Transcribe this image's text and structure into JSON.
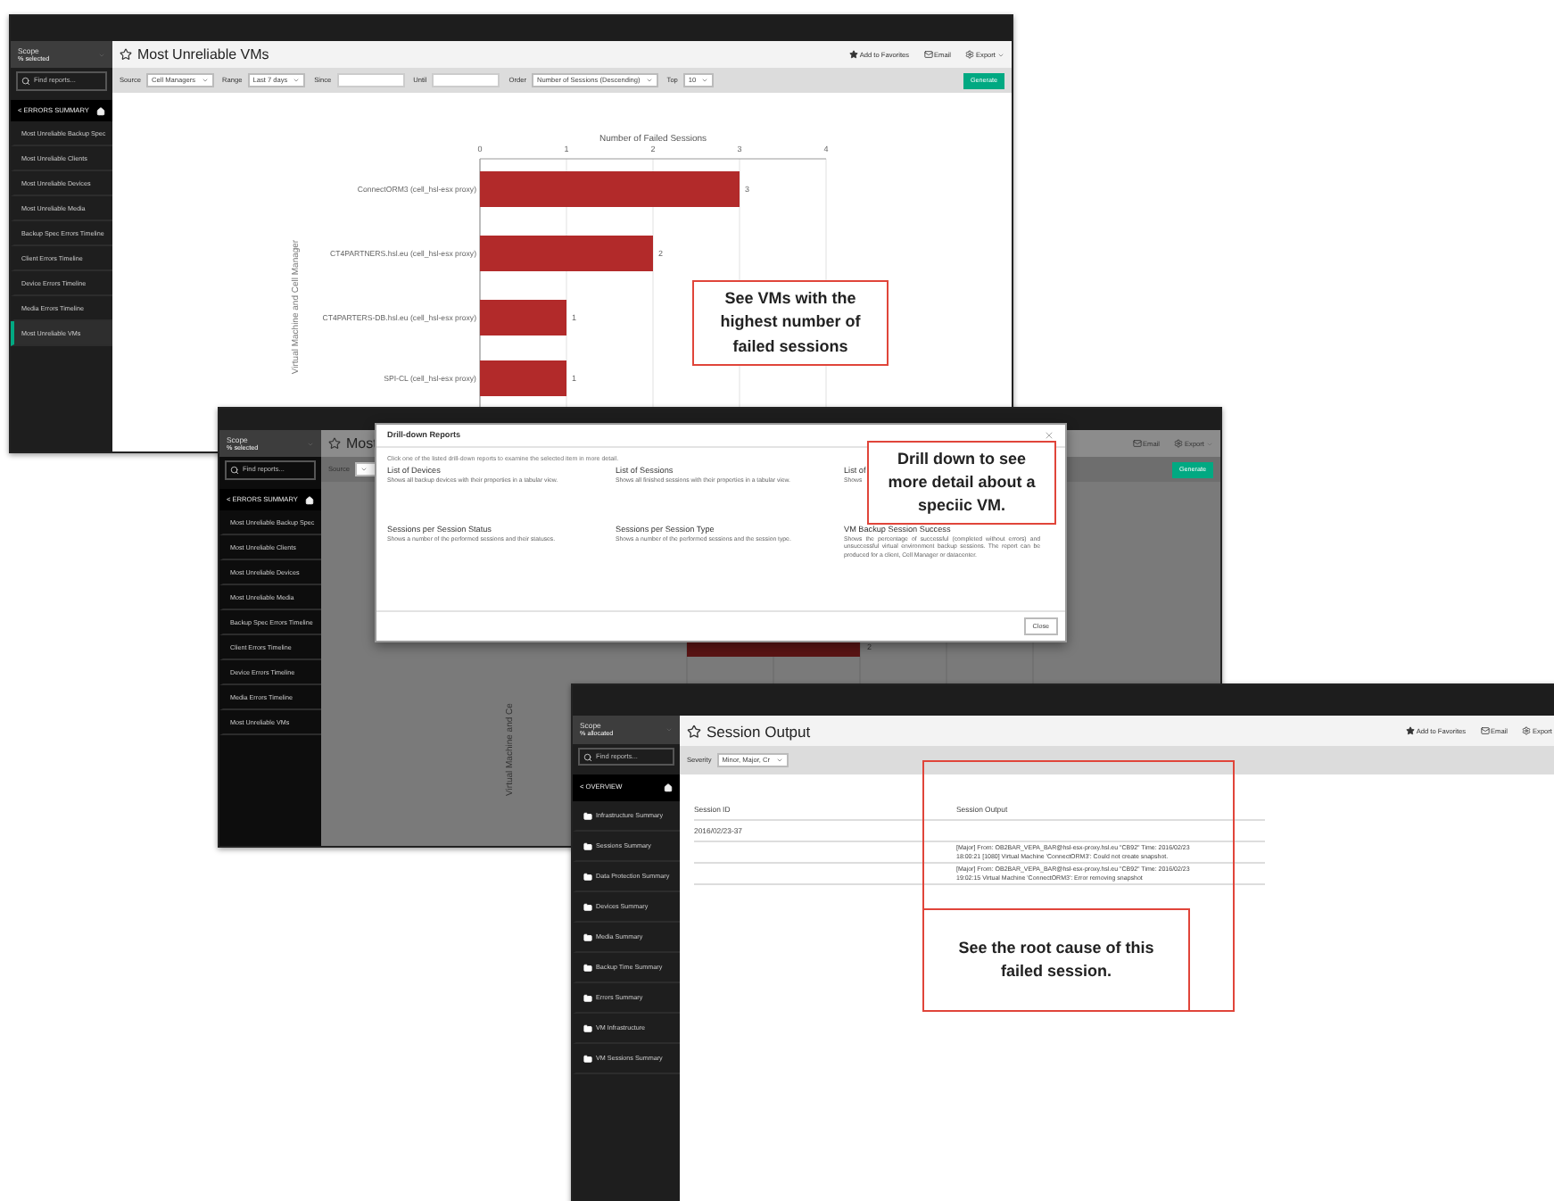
{
  "report_screen": {
    "sidebar": {
      "scope_label": "Scope",
      "scope_value": "% selected",
      "search_placeholder": "Find reports...",
      "section": "< ERRORS SUMMARY",
      "folder_icons": false,
      "items": [
        {
          "label": "Most Unreliable Backup Spec",
          "selected": false
        },
        {
          "label": "Most Unreliable Clients",
          "selected": false
        },
        {
          "label": "Most Unreliable Devices",
          "selected": false
        },
        {
          "label": "Most Unreliable Media",
          "selected": false
        },
        {
          "label": "Backup Spec Errors Timeline",
          "selected": false
        },
        {
          "label": "Client Errors Timeline",
          "selected": false
        },
        {
          "label": "Device Errors Timeline",
          "selected": false
        },
        {
          "label": "Media Errors Timeline",
          "selected": false
        },
        {
          "label": "Most Unreliable VMs",
          "selected": true
        }
      ]
    },
    "title": "Most Unreliable VMs",
    "actions": [
      {
        "kind": "star",
        "label": "Add to Favorites"
      },
      {
        "kind": "mail",
        "label": "Email"
      },
      {
        "kind": "gear",
        "label": "Export"
      }
    ],
    "filters": [
      {
        "kind": "select",
        "label": "Source",
        "value": "Cell Managers"
      },
      {
        "kind": "select",
        "label": "Range",
        "value": "Last 7 days"
      },
      {
        "kind": "input",
        "label": "Since"
      },
      {
        "kind": "input",
        "label": "Until"
      },
      {
        "kind": "select",
        "label": "Order",
        "value": "Number of Sessions (Descending)"
      },
      {
        "kind": "select",
        "label": "Top",
        "value": "10"
      }
    ],
    "generate": "Generate",
    "chart_data": {
      "type": "bar",
      "orientation": "horizontal",
      "title": "Number of Failed Sessions",
      "ylabel": "Virtual Machine and Cell Manager",
      "categories": [
        "ConnectORM3 (cell_hsl-esx proxy)",
        "CT4PARTNERS.hsl.eu (cell_hsl-esx proxy)",
        "CT4PARTERS-DB.hsl.eu (cell_hsl-esx proxy)",
        "SPI-CL (cell_hsl-esx proxy)"
      ],
      "series": [
        {
          "color": "#b22a2a",
          "values": [
            3,
            2,
            1,
            1
          ]
        }
      ],
      "xlim": [
        0,
        4
      ],
      "xticks": [
        0,
        1,
        2,
        3,
        4
      ],
      "grid": true,
      "data_labels": true
    }
  },
  "drilldown_screen": {
    "sidebar": {
      "scope_label": "Scope",
      "scope_value": "% selected",
      "search_placeholder": "Find reports...",
      "section": "< ERRORS SUMMARY",
      "folder_icons": false,
      "items": [
        {
          "label": "Most Unreliable Backup Spec",
          "selected": false
        },
        {
          "label": "Most Unreliable Clients",
          "selected": false
        },
        {
          "label": "Most Unreliable Devices",
          "selected": false
        },
        {
          "label": "Most Unreliable Media",
          "selected": false
        },
        {
          "label": "Backup Spec Errors Timeline",
          "selected": false
        },
        {
          "label": "Client Errors Timeline",
          "selected": false
        },
        {
          "label": "Device Errors Timeline",
          "selected": false
        },
        {
          "label": "Media Errors Timeline",
          "selected": false
        },
        {
          "label": "Most Unreliable VMs",
          "selected": false
        }
      ]
    },
    "title": "Most",
    "actions": [
      {
        "kind": "mail",
        "label": "Email"
      },
      {
        "kind": "gear",
        "label": "Export"
      }
    ],
    "filters": [
      {
        "kind": "select",
        "label": "Source"
      }
    ],
    "generate": "Generate",
    "axis_label": "Virtual Machine and Ce",
    "bar_value": "2",
    "modal": {
      "title": "Drill-down Reports",
      "intro": "Click one of the listed drill-down reports to examine the selected item in more detail.",
      "reports": [
        {
          "title": "List of Devices",
          "description": "Shows all backup devices with their properties in a tabular view."
        },
        {
          "title": "List of Sessions",
          "description": "Shows all finished sessions with their properties in a tabular view."
        },
        {
          "title": "List of",
          "description": "Shows"
        },
        {
          "title": "Sessions per Session Status",
          "description": "Shows a number of the performed sessions and their statuses."
        },
        {
          "title": "Sessions per Session Type",
          "description": "Shows a number of the performed sessions and the session type."
        },
        {
          "title": "VM Backup Session Success",
          "description": "Shows the percentage of successful (completed without errors) and unsuccessful virtual environment backup sessions. The report can be produced for a client, Cell Manager or datacenter."
        }
      ],
      "close": "Close"
    }
  },
  "session_screen": {
    "sidebar": {
      "scope_label": "Scope",
      "scope_value": "% allocated",
      "search_placeholder": "Find reports...",
      "section": "< OVERVIEW",
      "folder_icons": true,
      "items": [
        {
          "label": "Infrastructure Summary",
          "selected": false
        },
        {
          "label": "Sessions Summary",
          "selected": false
        },
        {
          "label": "Data Protection Summary",
          "selected": false
        },
        {
          "label": "Devices Summary",
          "selected": false
        },
        {
          "label": "Media Summary",
          "selected": false
        },
        {
          "label": "Backup Time Summary",
          "selected": false
        },
        {
          "label": "Errors Summary",
          "selected": false
        },
        {
          "label": "VM Infrastructure",
          "selected": false
        },
        {
          "label": "VM Sessions Summary",
          "selected": false
        }
      ]
    },
    "title": "Session Output",
    "actions": [
      {
        "kind": "star",
        "label": "Add to Favorites"
      },
      {
        "kind": "mail",
        "label": "Email"
      },
      {
        "kind": "gear",
        "label": "Export"
      }
    ],
    "filters": [
      {
        "kind": "select",
        "label": "Severity",
        "value": "Minor, Major, Cr"
      }
    ],
    "table": {
      "columns": [
        "Session ID",
        "Session Output"
      ],
      "rows": [
        {
          "session_id": "2016/02/23-37"
        },
        {
          "output": "[Major] From: OB2BAR_VEPA_BAR@hsl-esx-proxy.hsl.eu \"CB92\" Time: 2016/02/23 18:00:21 [1080] Virtual Machine 'ConnectORM3': Could not create snapshot."
        },
        {
          "output": "[Major] From: OB2BAR_VEPA_BAR@hsl-esx-proxy.hsl.eu \"CB92\" Time: 2016/02/23 19:02:15 Virtual Machine 'ConnectORM3': Error removing snapshot"
        }
      ]
    }
  },
  "callouts": [
    {
      "framed": false,
      "text": "See VMs with the highest number of failed sessions"
    },
    {
      "framed": false,
      "text": "Drill down to see more detail about a speciic VM."
    },
    {
      "framed": true,
      "text": "See the root cause of this failed session."
    }
  ]
}
